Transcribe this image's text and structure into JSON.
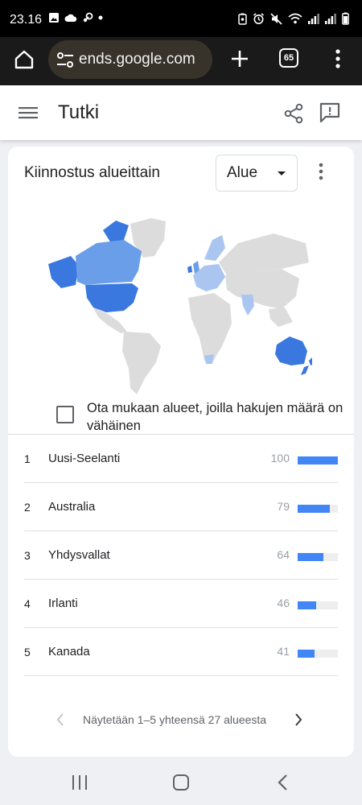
{
  "status_bar": {
    "time": "23.16"
  },
  "browser": {
    "url": "ends.google.com",
    "tab_count": "65"
  },
  "header": {
    "title": "Tutki"
  },
  "card": {
    "title": "Kiinnostus alueittain",
    "region_select": "Alue",
    "low_volume_label": "Ota mukaan alueet, joilla hakujen määrä on vähäinen"
  },
  "ranking": [
    {
      "rank": "1",
      "name": "Uusi-Seelanti",
      "score": "100",
      "value": 100
    },
    {
      "rank": "2",
      "name": "Australia",
      "score": "79",
      "value": 79
    },
    {
      "rank": "3",
      "name": "Yhdysvallat",
      "score": "64",
      "value": 64
    },
    {
      "rank": "4",
      "name": "Irlanti",
      "score": "46",
      "value": 46
    },
    {
      "rank": "5",
      "name": "Kanada",
      "score": "41",
      "value": 41
    }
  ],
  "pagination": {
    "text": "Näytetään 1–5 yhteensä 27 alueesta"
  },
  "colors": {
    "accent": "#4285f4",
    "map_base": "#dcdcdc",
    "map_dark": "#3a78e0",
    "map_mid": "#6a9ee8",
    "map_light": "#a9c5f0"
  },
  "icons": {
    "home": "home-icon",
    "tune": "tune-icon",
    "plus": "plus-icon",
    "menu": "more-vert-icon",
    "hamburger": "hamburger-icon",
    "share": "share-icon",
    "feedback": "feedback-icon"
  }
}
